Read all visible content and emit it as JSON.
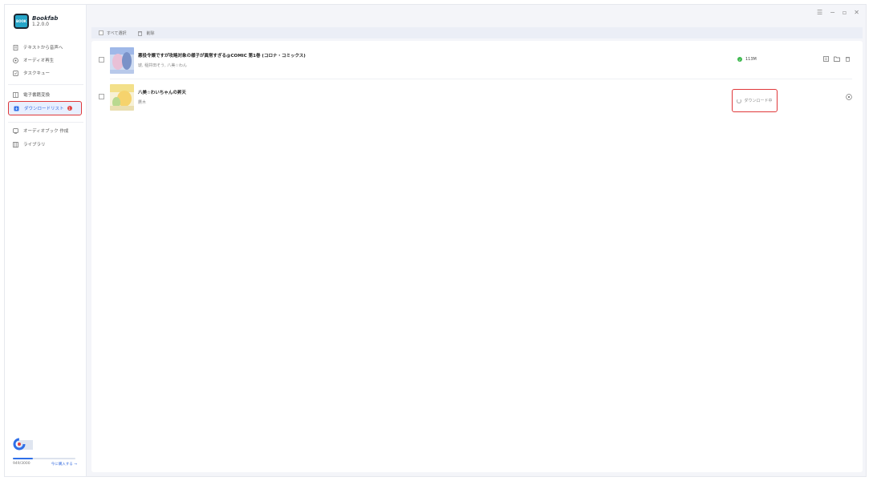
{
  "app": {
    "name": "Bookfab",
    "version": "1.2.0.0",
    "logo_text": "BOOK"
  },
  "window_controls": [
    "☰",
    "−",
    "▫",
    "✕"
  ],
  "sidebar": {
    "items": [
      {
        "label": "テキストから音声へ",
        "icon": "document-text-icon"
      },
      {
        "label": "オーディオ再生",
        "icon": "audio-play-icon"
      },
      {
        "label": "タスクキュー",
        "icon": "task-queue-icon"
      },
      {
        "label": "電子書籍変換",
        "icon": "ebook-convert-icon"
      },
      {
        "label": "ダウンロードリスト",
        "icon": "download-list-icon",
        "badge": "1",
        "active": true
      },
      {
        "label": "オーディオブック 作成",
        "icon": "audiobook-create-icon"
      },
      {
        "label": "ライブラリ",
        "icon": "library-icon"
      }
    ],
    "usage": {
      "text": "949/3000",
      "fraction": 0.32
    },
    "buy_label": "今に購入する →"
  },
  "toolbar": {
    "select_all": "すべて選択",
    "delete": "削除"
  },
  "downloads": [
    {
      "title": "悪役令嬢ですが攻略対象の様子が異常すぎる@COMIC 第1巻 (コロナ・コミックス)",
      "author": "琥, 稲井田そう, 八美☆わん",
      "status": "113M",
      "state": "done"
    },
    {
      "title": "八美☆わいちゃんの昇天",
      "author": "鷹木",
      "status": "ダウンロード中",
      "state": "downloading"
    }
  ],
  "colors": {
    "accent": "#2f6fe8",
    "highlight": "#e0383a",
    "success": "#3fb950"
  }
}
